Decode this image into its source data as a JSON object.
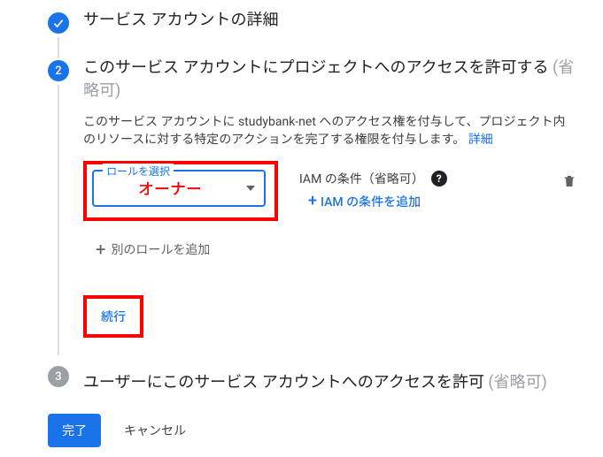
{
  "step1": {
    "title": "サービス アカウントの詳細"
  },
  "step2": {
    "number": "2",
    "title_main": "このサービス アカウントにプロジェクトへのアクセスを許可する ",
    "title_optional": "(省略可)",
    "description": "このサービス アカウントに studybank-net へのアクセス権を付与して、プロジェクト内のリソースに対する特定のアクションを完了する権限を付与します。",
    "details_link": "詳細",
    "role_select_label": "ロールを選択",
    "role_select_value": "オーナー",
    "iam_label": "IAM の条件（省略可）",
    "add_condition": "IAM の条件を追加",
    "add_role": "別のロールを追加",
    "continue": "続行"
  },
  "step3": {
    "number": "3",
    "title_main": "ユーザーにこのサービス アカウントへのアクセスを許可 ",
    "title_optional": "(省略可)"
  },
  "footer": {
    "done": "完了",
    "cancel": "キャンセル"
  }
}
